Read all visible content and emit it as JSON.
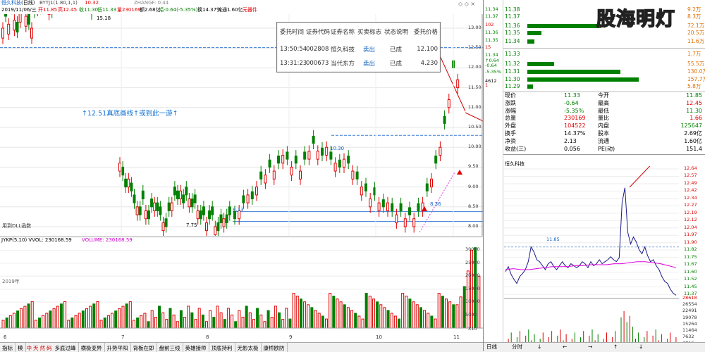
{
  "top_bar": {
    "stock_name": "恒久科技",
    "period": "(日线)",
    "indicator": "BYTJ1(1.80,1,1)",
    "indicator_value": "10.32",
    "zhangf": "ZHANGF: 0.44",
    "date": "2019/11/06/三",
    "open": "开11.85",
    "high": "高12.45",
    "low": "收11.30",
    "close": "低11.33",
    "volume": "量230169",
    "amount": "额2.68亿",
    "change": "幅-0.64(-5.35%)",
    "turnover": "换14.37%",
    "float": "流通1.60亿",
    "tool": "元器件"
  },
  "chart": {
    "price_high_label": "15.18",
    "price_low_label": "7.75",
    "annotation": "↑12.51真底画线↑或到此一游↑",
    "level_label_1": "10.30",
    "level_label_2": "8.13",
    "level_label_3": "8.36",
    "macro_label": "用到DLL函数",
    "y_ticks": [
      "13.00",
      "12.50",
      "12.00",
      "11.50",
      "11.00",
      "10.50",
      "10.00",
      "9.50",
      "9.00",
      "8.50",
      "8.00"
    ],
    "x_labels": [
      "6",
      "7",
      "8",
      "9",
      "10",
      "11"
    ],
    "volume_header": "JYKP(5,10)  VVOL: 230168.59",
    "volume_value": "VOLUME: 230168.59",
    "vol_ticks": [
      "30000",
      "25000",
      "20000",
      "15000",
      "10000",
      "5000"
    ],
    "vol_unit": "X10",
    "year_label": "2019年"
  },
  "popup": {
    "headers": [
      "委托时间",
      "证券代码",
      "证券名称",
      "买卖标志",
      "状态说明",
      "委托价格"
    ],
    "rows": [
      [
        "13:50:54",
        "002808",
        "恒久科技",
        "卖出",
        "已成",
        "12.100"
      ],
      [
        "13:31:23",
        "000673",
        "当代东方",
        "卖出",
        "已成",
        "4.230"
      ]
    ]
  },
  "right_axis_top": {
    "labels": [
      "11.34",
      "11.37",
      "102",
      "11.36",
      "11.35",
      "15",
      "11.34",
      "↑0.64",
      "-0.64",
      "-5.35%",
      "4612",
      "1"
    ]
  },
  "quotes_sell": [
    {
      "price": "11.38",
      "vol": "9.2万"
    },
    {
      "price": "11.37",
      "vol": "8.3万"
    },
    {
      "price": "11.36",
      "vol": "72.1万"
    },
    {
      "price": "11.35",
      "vol": "20.5万"
    },
    {
      "price": "11.34",
      "vol": "11.6万"
    }
  ],
  "quotes_buy": [
    {
      "price": "11.33",
      "vol": "1.7万"
    },
    {
      "price": "11.32",
      "vol": "55.5万"
    },
    {
      "price": "11.31",
      "vol": "130.0万"
    },
    {
      "price": "11.30",
      "vol": "157.7万"
    },
    {
      "price": "11.29",
      "vol": "5.8万"
    }
  ],
  "watermark": "股海明灯",
  "stats": [
    {
      "l1": "现价",
      "v1": "11.33",
      "l2": "今开",
      "v2": "11.85",
      "c1": "grn",
      "c2": "grn"
    },
    {
      "l1": "涨跌",
      "v1": "-0.64",
      "l2": "最高",
      "v2": "12.45",
      "c1": "grn",
      "c2": "red"
    },
    {
      "l1": "涨幅",
      "v1": "-5.35%",
      "l2": "最低",
      "v2": "11.30",
      "c1": "grn",
      "c2": "grn"
    },
    {
      "l1": "总量",
      "v1": "230169",
      "l2": "量比",
      "v2": "1.66",
      "c1": "red",
      "c2": "red"
    },
    {
      "l1": "外盘",
      "v1": "104522",
      "l2": "内盘",
      "v2": "125647",
      "c1": "red",
      "c2": "grn"
    },
    {
      "l1": "换手",
      "v1": "14.37%",
      "l2": "股本",
      "v2": "2.69亿",
      "c1": "blk",
      "c2": "blk"
    },
    {
      "l1": "净资",
      "v1": "2.13",
      "l2": "流通",
      "v2": "1.60亿",
      "c1": "blk",
      "c2": "blk"
    },
    {
      "l1": "收益(三)",
      "v1": "0.056",
      "l2": "PE(动)",
      "v2": "151.4",
      "c1": "blk",
      "c2": "blk"
    }
  ],
  "intraday": {
    "name": "恒久科技",
    "ticks": [
      "12.64",
      "12.57",
      "12.49",
      "12.42",
      "12.34",
      "12.27",
      "12.19",
      "12.12",
      "12.04",
      "11.97",
      "11.90",
      "11.82",
      "11.75",
      "11.67",
      "11.60",
      "11.52",
      "11.45",
      "11.37"
    ],
    "avg_label": "11.85",
    "vol_ticks": [
      "28618",
      "26554",
      "22491",
      "19078",
      "15264",
      "11464",
      "7632",
      "3816"
    ]
  },
  "bottom_tabs": [
    "指标",
    "模",
    "中",
    "天",
    "然",
    "码",
    "多底过峰",
    "横极变异",
    "升势平阳",
    "背板在即",
    "盘前三线",
    "英雄接师",
    "顶底持利",
    "无影太极",
    "康桥欧防"
  ],
  "bottom_right": [
    "日线",
    "分时",
    "↓",
    "←",
    "→",
    "↑",
    "↓"
  ]
}
